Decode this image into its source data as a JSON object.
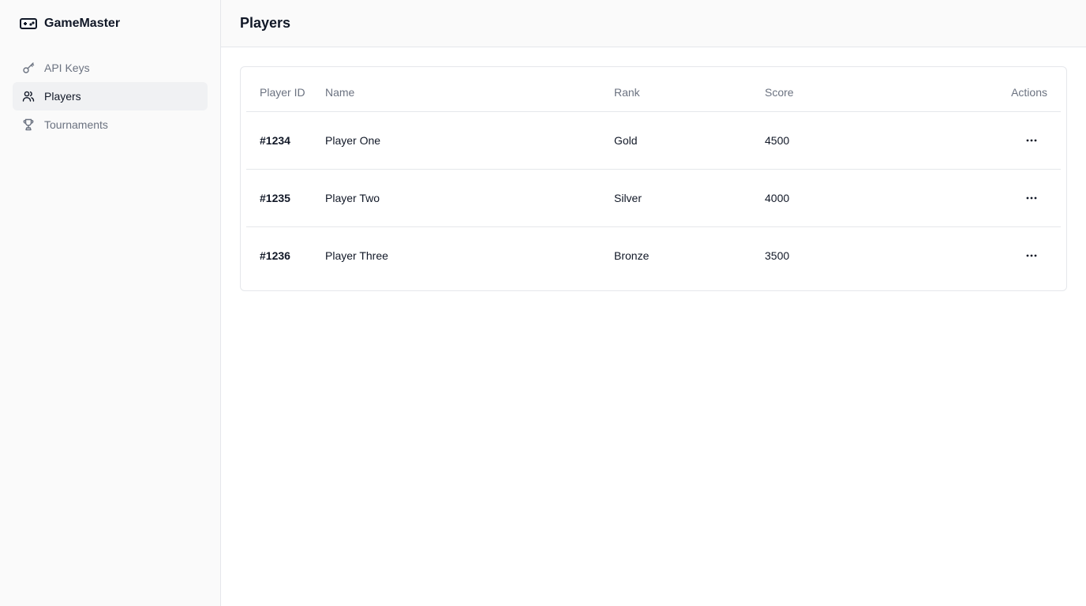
{
  "app": {
    "name": "GameMaster",
    "icon": "gamepad-icon"
  },
  "sidebar": {
    "items": [
      {
        "label": "API Keys",
        "icon": "key-icon",
        "active": false
      },
      {
        "label": "Players",
        "icon": "users-icon",
        "active": true
      },
      {
        "label": "Tournaments",
        "icon": "trophy-icon",
        "active": false
      }
    ]
  },
  "header": {
    "title": "Players"
  },
  "table": {
    "columns": [
      "Player ID",
      "Name",
      "Rank",
      "Score",
      "Actions"
    ],
    "rows": [
      {
        "id": "#1234",
        "name": "Player One",
        "rank": "Gold",
        "score": "4500",
        "action_icon": "more-horizontal-icon"
      },
      {
        "id": "#1235",
        "name": "Player Two",
        "rank": "Silver",
        "score": "4000",
        "action_icon": "more-horizontal-icon"
      },
      {
        "id": "#1236",
        "name": "Player Three",
        "rank": "Bronze",
        "score": "3500",
        "action_icon": "more-horizontal-icon"
      }
    ]
  },
  "colors": {
    "sidebar_bg": "#fafafa",
    "active_bg": "#f0f1f3",
    "muted_text": "#6b7280",
    "text": "#111827",
    "border": "#e5e7eb"
  }
}
